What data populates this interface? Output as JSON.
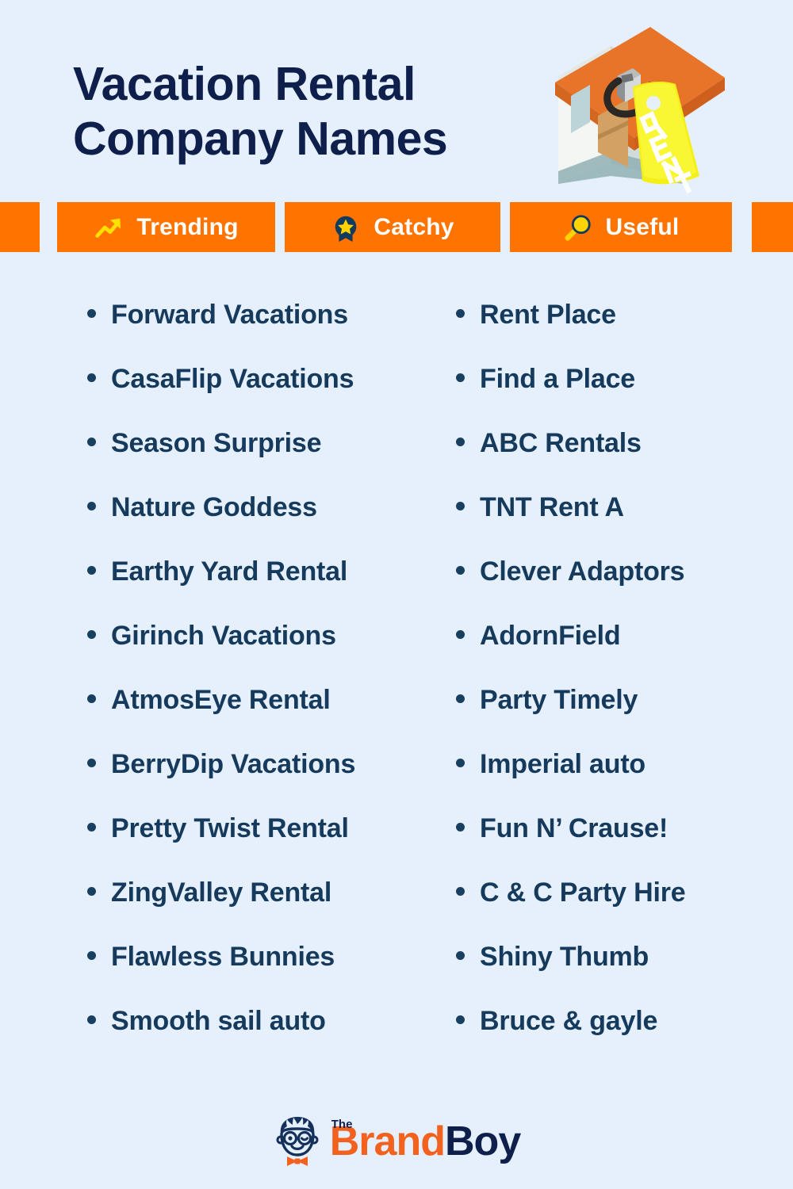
{
  "page": {
    "background_color": "#e6f0fd",
    "title_color": "#0e1f4b",
    "accent_orange": "#ff7300",
    "accent_yellow": "#ffe000",
    "list_text_color": "#153a5b"
  },
  "header": {
    "title_line1": "Vacation Rental",
    "title_line2": "Company Names",
    "illustration": {
      "name": "house-with-rent-tag-illustration",
      "tag_text": "RENT",
      "roof_color": "#e8742a",
      "wall_color": "#f2f4f2",
      "door_color": "#d3a164",
      "tag_color": "#f5ef18"
    }
  },
  "badges": [
    {
      "label": "Trending",
      "icon": "trending-up-icon"
    },
    {
      "label": "Catchy",
      "icon": "award-star-icon"
    },
    {
      "label": "Useful",
      "icon": "magnifier-icon"
    }
  ],
  "lists": {
    "left_column": [
      "Forward Vacations",
      "CasaFlip Vacations",
      "Season Surprise",
      "Nature Goddess",
      "Earthy Yard Rental",
      "Girinch Vacations",
      "AtmosEye Rental",
      "BerryDip Vacations",
      "Pretty Twist Rental",
      "ZingValley Rental",
      "Flawless Bunnies",
      "Smooth sail auto"
    ],
    "right_column": [
      "Rent Place",
      "Find a Place",
      "ABC Rentals",
      "TNT Rent A",
      "Clever Adaptors",
      "AdornField",
      "Party Timely",
      "Imperial auto",
      "Fun N’ Crause!",
      "C & C Party Hire",
      "Shiny Thumb",
      "Bruce & gayle"
    ]
  },
  "footer": {
    "logo_the": "The",
    "logo_brand": "Brand",
    "logo_boy": "Boy",
    "logo_mark": "brandboy-mascot-icon"
  }
}
